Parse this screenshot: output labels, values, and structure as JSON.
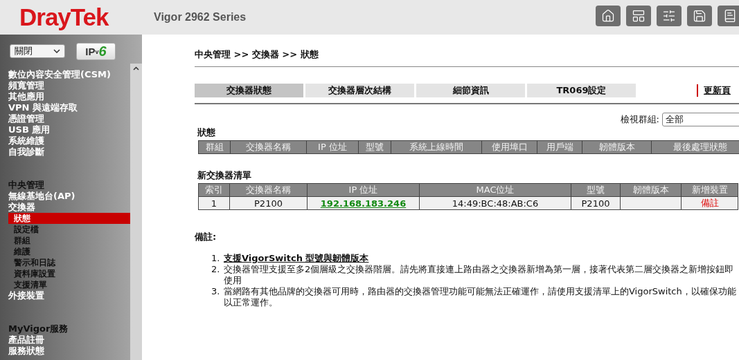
{
  "header": {
    "logo": "DrayTek",
    "model": "Vigor 2962 Series"
  },
  "sidebar": {
    "language": "關閉",
    "ipv6": {
      "ip": "IP",
      "v": "v",
      "six": "6"
    },
    "groups": [
      {
        "items": [
          {
            "label": "數位內容安全管理(CSM)",
            "kind": "item"
          },
          {
            "label": "頻寬管理",
            "kind": "item"
          },
          {
            "label": "其他應用",
            "kind": "item"
          },
          {
            "label": "VPN 與遠端存取",
            "kind": "item"
          },
          {
            "label": "憑證管理",
            "kind": "item"
          },
          {
            "label": "USB 應用",
            "kind": "item"
          },
          {
            "label": "系統維護",
            "kind": "item"
          },
          {
            "label": "自我診斷",
            "kind": "item"
          }
        ]
      },
      {
        "items": [
          {
            "label": "中央管理",
            "kind": "heading"
          },
          {
            "label": "無線基地台(AP)",
            "kind": "item"
          },
          {
            "label": "交換器",
            "kind": "item",
            "children": [
              {
                "label": "狀態",
                "selected": true
              },
              {
                "label": "設定檔",
                "selected": false
              },
              {
                "label": "群組",
                "selected": false
              },
              {
                "label": "維護",
                "selected": false
              },
              {
                "label": "警示和日誌",
                "selected": false
              },
              {
                "label": "資料庫設置",
                "selected": false
              },
              {
                "label": "支援清單",
                "selected": false
              }
            ]
          },
          {
            "label": "外接裝置",
            "kind": "item"
          }
        ]
      },
      {
        "items": [
          {
            "label": "MyVigor服務",
            "kind": "heading"
          },
          {
            "label": "產品註冊",
            "kind": "item"
          },
          {
            "label": "服務狀態",
            "kind": "item"
          }
        ]
      }
    ]
  },
  "main": {
    "breadcrumb": "中央管理 >> 交換器 >> 狀態",
    "tabs": [
      {
        "label": "交換器狀態",
        "selected": true
      },
      {
        "label": "交換器層次結構",
        "selected": false
      },
      {
        "label": "細節資訊",
        "selected": false
      },
      {
        "label": "TR069設定",
        "selected": false
      }
    ],
    "refresh_link": "更新頁",
    "view_group": {
      "label": "檢視群組:",
      "value": "全部"
    },
    "status_section": {
      "title": "狀態",
      "columns": [
        "群組",
        "交換器名稱",
        "IP 位址",
        "型號",
        "系統上線時間",
        "使用埠口",
        "用戶端",
        "韌體版本",
        "最後處理狀態"
      ]
    },
    "new_switch_section": {
      "title": "新交換器清單",
      "columns": [
        "索引",
        "交換器名稱",
        "IP 位址",
        "MAC位址",
        "型號",
        "韌體版本",
        "新增裝置"
      ],
      "rows": [
        {
          "index": "1",
          "name": "P2100",
          "ip": "192.168.183.246",
          "mac": "14:49:BC:48:AB:C6",
          "model": "P2100",
          "add": "備註"
        }
      ]
    },
    "notes": {
      "title": "備註:",
      "items": [
        {
          "kind": "link",
          "number": "1.",
          "lines": [
            "支援VigorSwitch 型號與韌體版本"
          ]
        },
        {
          "kind": "text",
          "number": "2.",
          "lines": [
            "交換器管理支援至多2個層級之交換器階層。請先將直接連上路由器之交換器新增為第一層，接著代表第二層交換器之新增按鈕即",
            "使用"
          ]
        },
        {
          "kind": "text",
          "number": "3.",
          "lines": [
            "當網路有其他品牌的交換器可用時，路由器的交換器管理功能可能無法正確運作，請使用支援清單上的VigorSwitch，以確保功能",
            "以正常運作。"
          ]
        }
      ]
    }
  }
}
